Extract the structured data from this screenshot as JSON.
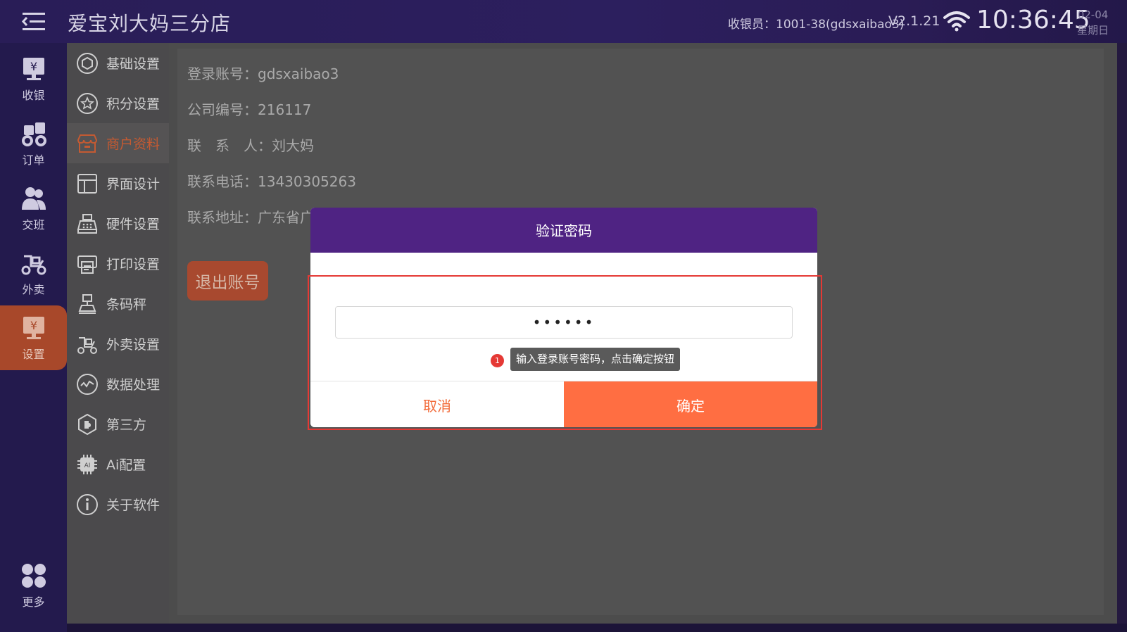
{
  "header": {
    "title": "爱宝刘大妈三分店",
    "cashier": "收银员：1001-38(gdsxaibao3)",
    "version": "V2.1.21",
    "time": "10:36:45",
    "date": "02-04",
    "weekday": "星期日"
  },
  "rail": {
    "items": [
      {
        "label": "收银",
        "icon": "cashier-icon"
      },
      {
        "label": "订单",
        "icon": "order-icon"
      },
      {
        "label": "交班",
        "icon": "shift-icon"
      },
      {
        "label": "外卖",
        "icon": "delivery-icon"
      },
      {
        "label": "设置",
        "icon": "settings-icon",
        "active": true
      }
    ],
    "more": {
      "label": "更多",
      "icon": "more-grid-icon"
    }
  },
  "settings_menu": {
    "items": [
      {
        "label": "基础设置",
        "icon": "hexagon-icon"
      },
      {
        "label": "积分设置",
        "icon": "star-circle-icon"
      },
      {
        "label": "商户资料",
        "icon": "store-icon",
        "active": true
      },
      {
        "label": "界面设计",
        "icon": "layout-icon"
      },
      {
        "label": "硬件设置",
        "icon": "register-icon"
      },
      {
        "label": "打印设置",
        "icon": "printer-icon"
      },
      {
        "label": "条码秤",
        "icon": "scale-icon"
      },
      {
        "label": "外卖设置",
        "icon": "scooter-icon"
      },
      {
        "label": "数据处理",
        "icon": "wave-circle-icon"
      },
      {
        "label": "第三方",
        "icon": "puzzle-icon"
      },
      {
        "label": "Ai配置",
        "icon": "ai-chip-icon"
      },
      {
        "label": "关于软件",
        "icon": "info-icon"
      }
    ]
  },
  "merchant": {
    "account": "登录账号：gdsxaibao3",
    "company": "公司编号：216117",
    "contact": "联　系　人：刘大妈",
    "phone": "联系电话：13430305263",
    "address": "联系地址：广东省广",
    "logout_label": "退出账号"
  },
  "dialog": {
    "title": "验证密码",
    "password_value": "••••••",
    "hint_number": "1",
    "hint_text": "输入登录账号密码，点击确定按钮",
    "cancel_label": "取消",
    "confirm_label": "确定"
  },
  "colors": {
    "header_purple": "#4f2383",
    "accent_orange": "#ff6e42",
    "active_rail": "#a8482a",
    "highlight_red": "#e53935"
  }
}
